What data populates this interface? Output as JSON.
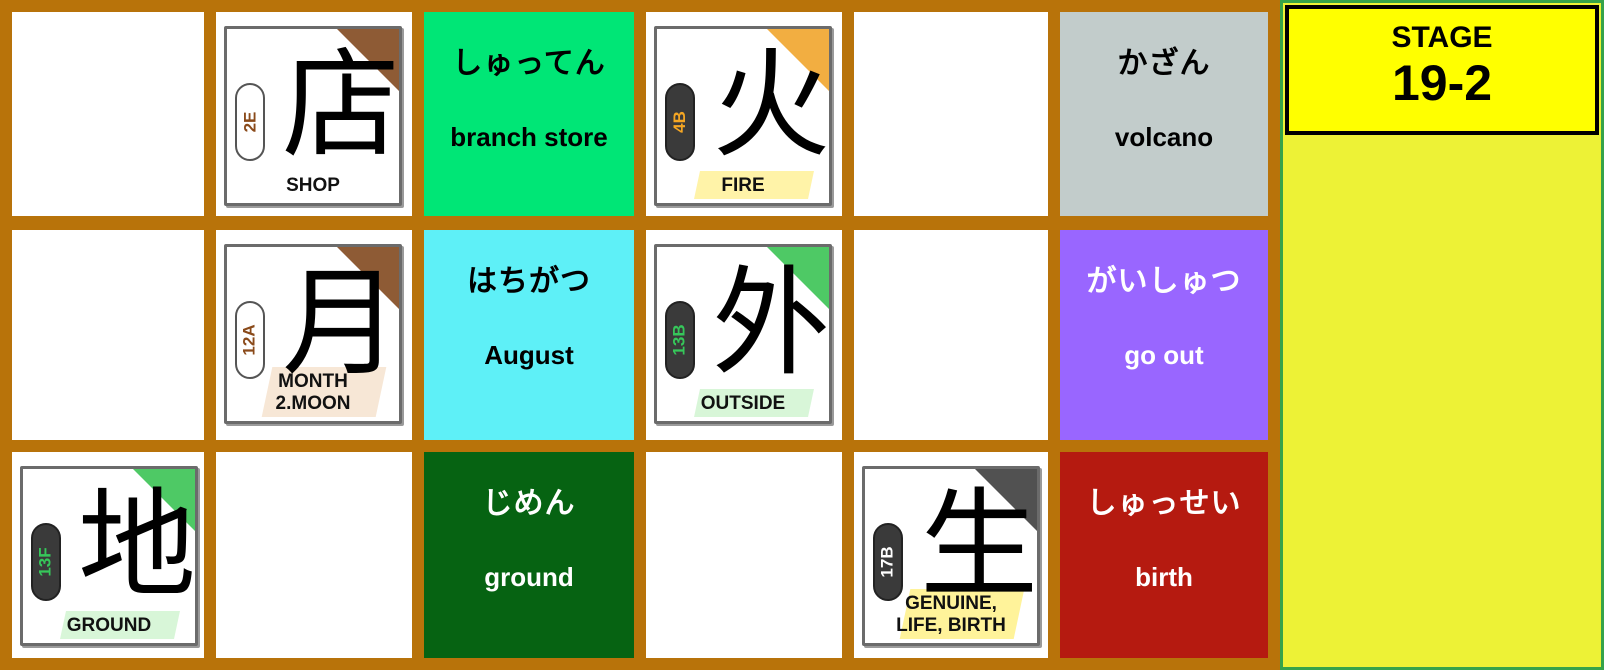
{
  "stage": {
    "label": "STAGE",
    "number": "19-2"
  },
  "kanji_cards": [
    {
      "kanji": "店",
      "code": "2E",
      "meaning": "SHOP",
      "code_color": "#8a4a1a",
      "cloud": "light",
      "corner": "#7a3e12",
      "label_bg": "#ffffff"
    },
    {
      "kanji": "火",
      "code": "4B",
      "meaning": "FIRE",
      "code_color": "#f5a623",
      "cloud": "dark",
      "corner": "#f0a020",
      "label_bg": "#fff3a8"
    },
    {
      "kanji": "月",
      "code": "12A",
      "meaning": "MONTH\n2.MOON",
      "code_color": "#8a4a1a",
      "cloud": "light",
      "corner": "#7a3e12",
      "label_bg": "#f7e7d6"
    },
    {
      "kanji": "外",
      "code": "13B",
      "meaning": "OUTSIDE",
      "code_color": "#36c75a",
      "cloud": "dark",
      "corner": "#2fbf4a",
      "label_bg": "#d8f6d8"
    },
    {
      "kanji": "地",
      "code": "13F",
      "meaning": "GROUND",
      "code_color": "#36c75a",
      "cloud": "dark",
      "corner": "#2fbf4a",
      "label_bg": "#d8f6d8"
    },
    {
      "kanji": "生",
      "code": "17B",
      "meaning": "GENUINE,\nLIFE, BIRTH",
      "code_color": "#ffffff",
      "cloud": "dark",
      "corner": "#333333",
      "label_bg": "#fff39a"
    }
  ],
  "word_cards": [
    {
      "reading": "しゅってん",
      "meaning": "branch store",
      "bg": "#00e676",
      "text_color": "#000000"
    },
    {
      "reading": "かざん",
      "meaning": "volcano",
      "bg": "#c2cccb",
      "text_color": "#000000"
    },
    {
      "reading": "はちがつ",
      "meaning": "August",
      "bg": "#5ef0f7",
      "text_color": "#000000"
    },
    {
      "reading": "がいしゅつ",
      "meaning": "go out",
      "bg": "#9966ff",
      "text_color": "#ffffff"
    },
    {
      "reading": "じめん",
      "meaning": "ground",
      "bg": "#066312",
      "text_color": "#ffffff"
    },
    {
      "reading": "しゅっせい",
      "meaning": "birth",
      "bg": "#b51a10",
      "text_color": "#ffffff"
    }
  ]
}
